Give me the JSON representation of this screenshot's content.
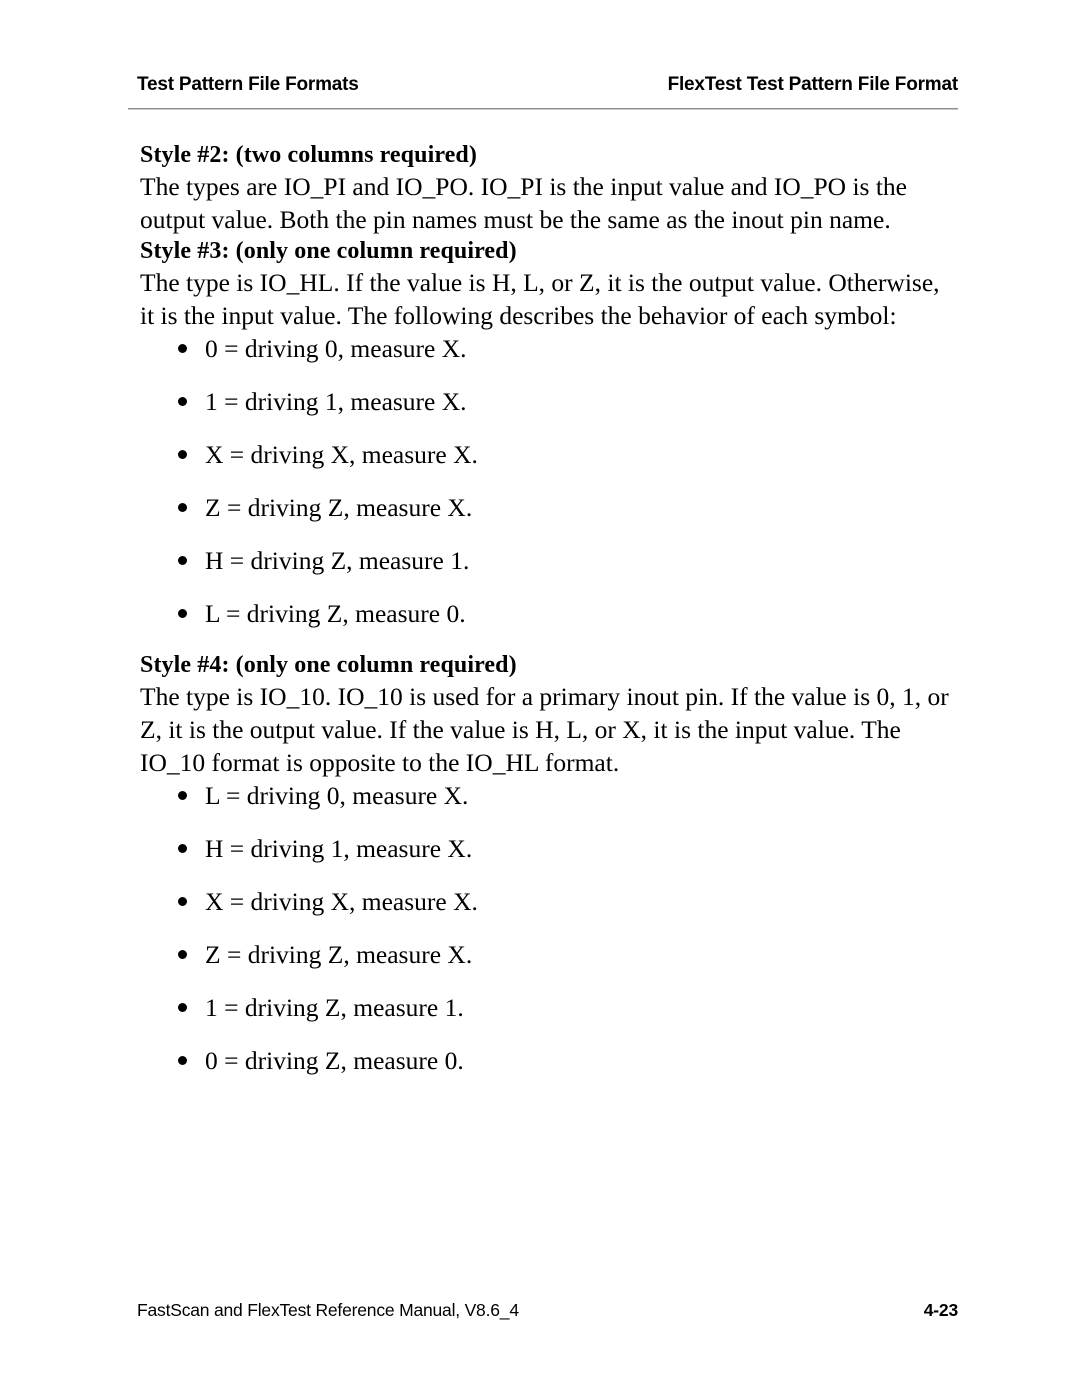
{
  "header": {
    "left_title": "Test Pattern File Formats",
    "right_title": "FlexTest Test Pattern File Format"
  },
  "sections": [
    {
      "heading": "Style #2: (two columns required)",
      "paragraph": "The types are IO_PI and IO_PO. IO_PI is the input value and IO_PO is the output value. Both the pin names must be the same as the inout pin name.",
      "bullets": []
    },
    {
      "heading": "Style #3: (only one column required)",
      "paragraph": "The type is IO_HL. If the value is H, L, or Z, it is the output value. Otherwise, it is the input value. The following describes the behavior of each symbol:",
      "bullets": [
        "0 = driving 0, measure X.",
        "1 = driving 1, measure X.",
        "X = driving X, measure X.",
        "Z = driving Z, measure X.",
        "H = driving Z, measure 1.",
        "L = driving Z, measure 0."
      ]
    },
    {
      "heading": "Style #4: (only one column required)",
      "paragraph": "The type is IO_10. IO_10 is used for a primary inout pin. If the value is 0, 1, or Z, it is the output value. If the value is H, L, or X, it is the input value. The IO_10 format is opposite to the IO_HL format.",
      "bullets": [
        "L = driving 0, measure X.",
        "H = driving 1, measure X.",
        "X = driving X, measure X.",
        "Z = driving Z, measure X.",
        "1 = driving Z, measure 1.",
        "0 = driving Z, measure 0."
      ]
    }
  ],
  "footer": {
    "manual_reference": "FastScan and FlexTest Reference Manual, V8.6_4",
    "page_number": "4-23"
  },
  "colors": {
    "page_background": "#ffffff",
    "text": "#000000",
    "rule_line": "#8f8f8f"
  }
}
